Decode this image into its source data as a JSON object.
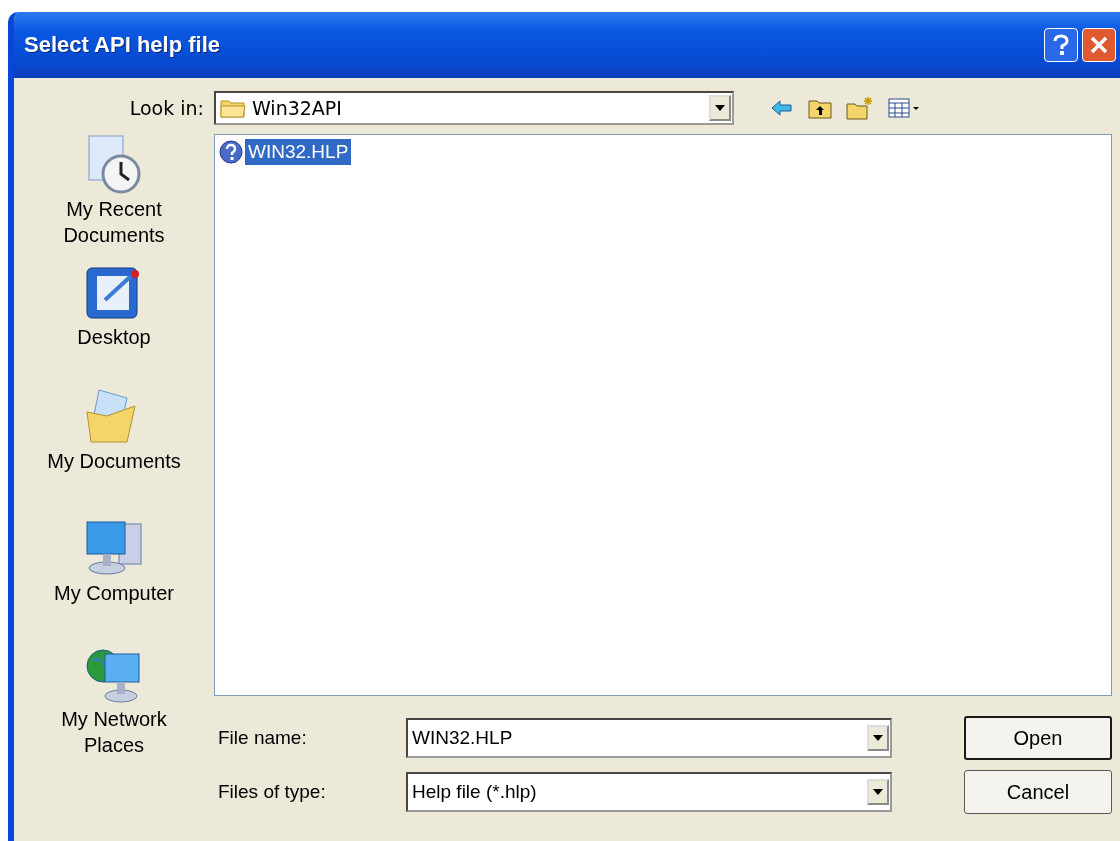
{
  "window": {
    "title": "Select API help file"
  },
  "look_in": {
    "label": "Look in:",
    "value": "Win32API"
  },
  "places": [
    {
      "label": "My Recent Documents",
      "kind": "recent"
    },
    {
      "label": "Desktop",
      "kind": "desktop"
    },
    {
      "label": "My Documents",
      "kind": "documents"
    },
    {
      "label": "My Computer",
      "kind": "computer"
    },
    {
      "label": "My Network Places",
      "kind": "network"
    }
  ],
  "files": [
    {
      "name": "WIN32.HLP",
      "selected": true
    }
  ],
  "file_name": {
    "label": "File name:",
    "value": "WIN32.HLP"
  },
  "file_type": {
    "label": "Files of type:",
    "value": "Help file (*.hlp)"
  },
  "buttons": [
    {
      "label": "Open",
      "default": true
    },
    {
      "label": "Cancel",
      "default": false
    }
  ]
}
